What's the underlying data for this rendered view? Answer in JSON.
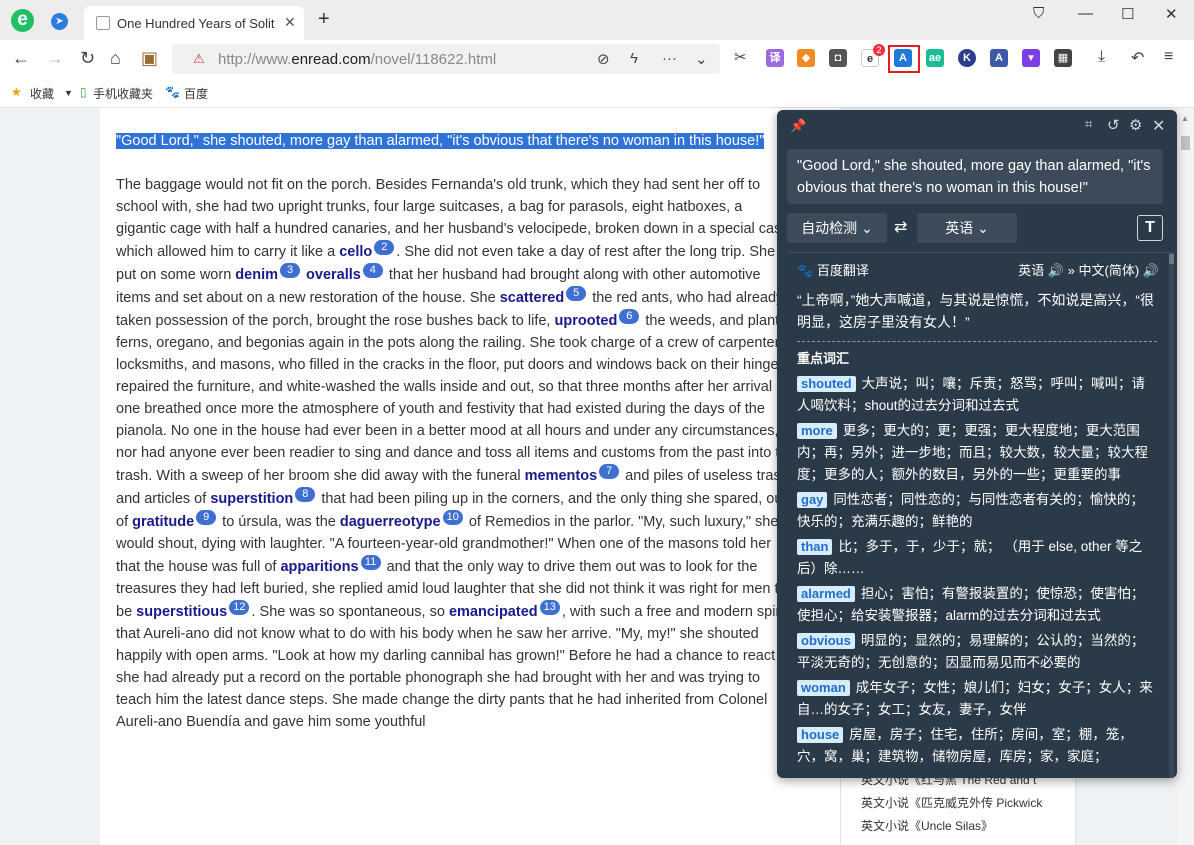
{
  "tab": {
    "title": "One Hundred Years of Solit"
  },
  "address": {
    "url_prefix": "http://www.",
    "domain": "enread.com",
    "path": "/novel/118622.html"
  },
  "extensions": {
    "badge_count": "2",
    "ext_labels": [
      "译",
      "ae",
      "K",
      "A"
    ]
  },
  "bookmarks": [
    "收藏",
    "手机收藏夹",
    "百度"
  ],
  "article": {
    "highlight": "\"Good Lord,\" she shouted, more gay than alarmed, \"it's obvious that there's no woman in this house!\"",
    "segments": [
      {
        "t": "The baggage would not fit on the porch. Besides Fernanda's old trunk, which they had sent her off to school with, she had two upright trunks, four large suitcases, a bag for parasols, eight hatboxes, a gigantic cage with half a hundred canaries, and her husband's velocipede, broken down in a special case which allowed him to carry it like a "
      },
      {
        "w": "cello",
        "n": "2"
      },
      {
        "t": ". She did not even take a day of rest after the long trip. She put on some worn "
      },
      {
        "w": "denim",
        "n": "3"
      },
      {
        "w": "overalls",
        "n": "4"
      },
      {
        "t": " that her husband had brought along with other automotive items and set about on a new restoration of the house. She "
      },
      {
        "w": "scattered",
        "n": "5"
      },
      {
        "t": " the red ants, who had already taken possession of the porch, brought the rose bushes back to life, "
      },
      {
        "w": "uprooted",
        "n": "6"
      },
      {
        "t": " the weeds, and planted ferns, oregano, and begonias again in the pots along the railing. She took charge of a crew of carpenters, locksmiths, and masons, who filled in the cracks in the floor, put doors and windows back on their hinges, repaired the furniture, and white-washed the walls inside and out, so that three months after her arrival one breathed once more the atmosphere of youth and festivity that had existed during the days of the pianola. No one in the house had ever been in a better mood at all hours and under any circumstances, nor had anyone ever been readier to sing and dance and toss all items and customs from the past into the trash. With a sweep of her broom she did away with the funeral "
      },
      {
        "w": "mementos",
        "n": "7"
      },
      {
        "t": " and piles of useless trash and articles of "
      },
      {
        "w": "superstition",
        "n": "8"
      },
      {
        "t": " that had been piling up in the corners, and the only thing she spared, out of "
      },
      {
        "w": "gratitude",
        "n": "9"
      },
      {
        "t": " to úrsula, was the "
      },
      {
        "w": "daguerreotype",
        "n": "10"
      },
      {
        "t": " of Remedios in the parlor. \"My, such luxury,\" she would shout, dying with laughter. \"A fourteen-year-old grandmother!\" When one of the masons told her that the house was full of "
      },
      {
        "w": "apparitions",
        "n": "11"
      },
      {
        "t": " and that the only way to drive them out was to look for the treasures they had left buried, she replied amid loud laughter that she did not think it was right for men to be "
      },
      {
        "w": "superstitious",
        "n": "12"
      },
      {
        "t": ". She was so spontaneous, so "
      },
      {
        "w": "emancipated",
        "n": "13"
      },
      {
        "t": ", with such a free and modern spirit, that Aureli-ano did not know what to do with his body when he saw her arrive. \"My, my!\" she shouted happily with open arms. \"Look at how my darling cannibal has grown!\" Before he had a chance to react she had already put a record on the portable phonograph she had brought with her and was trying to teach him the latest dance steps. She made change the dirty pants that he had inherited from Colonel Aureli-ano Buendía and gave him some youthful"
      }
    ]
  },
  "sidepanel": {
    "items": [
      "英文小说《红与黑 The Red and t",
      "英文小说《匹克威克外传 Pickwick",
      "英文小说《Uncle Silas》"
    ]
  },
  "popup": {
    "source_text": "\"Good Lord,\" she shouted, more gay than alarmed, \"it's obvious that there's no woman in this house!\"",
    "source_lang": "自动检测",
    "target_lang": "英语",
    "engine": "百度翻译",
    "lang_pair_from": "英语",
    "lang_pair_to": "中文(简体)",
    "translation": "“上帝啊，”她大声喊道，与其说是惊慌，不如说是高兴，“很明显，这房子里没有女人！”",
    "vocab_title": "重点词汇",
    "vocab": [
      {
        "word": "shouted",
        "def": "大声说；叫；嚷；斥责；怒骂；呼叫；喊叫；请人喝饮料；shout的过去分词和过去式"
      },
      {
        "word": "more",
        "def": "更多；更大的；更；更强；更大程度地；更大范围内；再；另外；进一步地；而且；较大数，较大量；较大程度；更多的人；额外的数目，另外的一些；更重要的事"
      },
      {
        "word": "gay",
        "def": "同性恋者；同性恋的；与同性恋者有关的；愉快的；快乐的；充满乐趣的；鲜艳的"
      },
      {
        "word": "than",
        "def": "比；多于，于，少于；就； （用于 else, other 等之后）除……"
      },
      {
        "word": "alarmed",
        "def": "担心；害怕；有警报装置的；使惊恐；使害怕；使担心；给安装警报器；alarm的过去分词和过去式"
      },
      {
        "word": "obvious",
        "def": "明显的；显然的；易理解的；公认的；当然的；平淡无奇的；无创意的；因显而易见而不必要的"
      },
      {
        "word": "woman",
        "def": "成年女子；女性；娘儿们；妇女；女子；女人；来自…的女子；女工；女友，妻子，女伴"
      },
      {
        "word": "house",
        "def": "房屋，房子；住宅，住所；房间，室；棚，笼，穴，窝，巢；建筑物，储物房屋，库房；家，家庭；"
      }
    ]
  }
}
